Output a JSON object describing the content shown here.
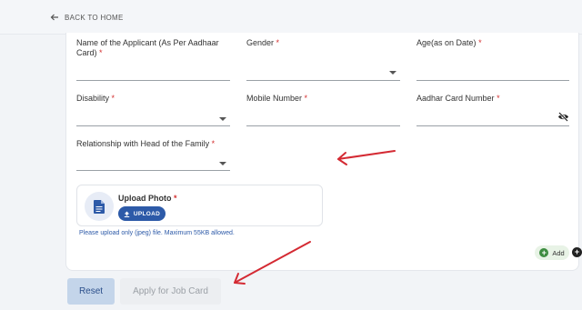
{
  "nav": {
    "back_label": "BACK TO HOME"
  },
  "form": {
    "applicant_name_label": "Name of the Applicant (As Per Aadhaar Card)",
    "gender_label": "Gender",
    "age_label": "Age(as on Date)",
    "disability_label": "Disability",
    "mobile_label": "Mobile Number",
    "aadhar_label": "Aadhar Card Number",
    "relationship_label": "Relationship with Head of the Family",
    "required_mark": "*"
  },
  "upload": {
    "title": "Upload Photo",
    "button_label": "UPLOAD",
    "hint": "Please upload only (jpeg) file. Maximum 55KB allowed."
  },
  "actions": {
    "add_label": "Add",
    "reset_label": "Reset",
    "apply_label": "Apply for Job Card"
  },
  "colors": {
    "annotation_arrow": "#d42a33",
    "primary": "#2d5aa8",
    "required": "#d32f2f"
  }
}
